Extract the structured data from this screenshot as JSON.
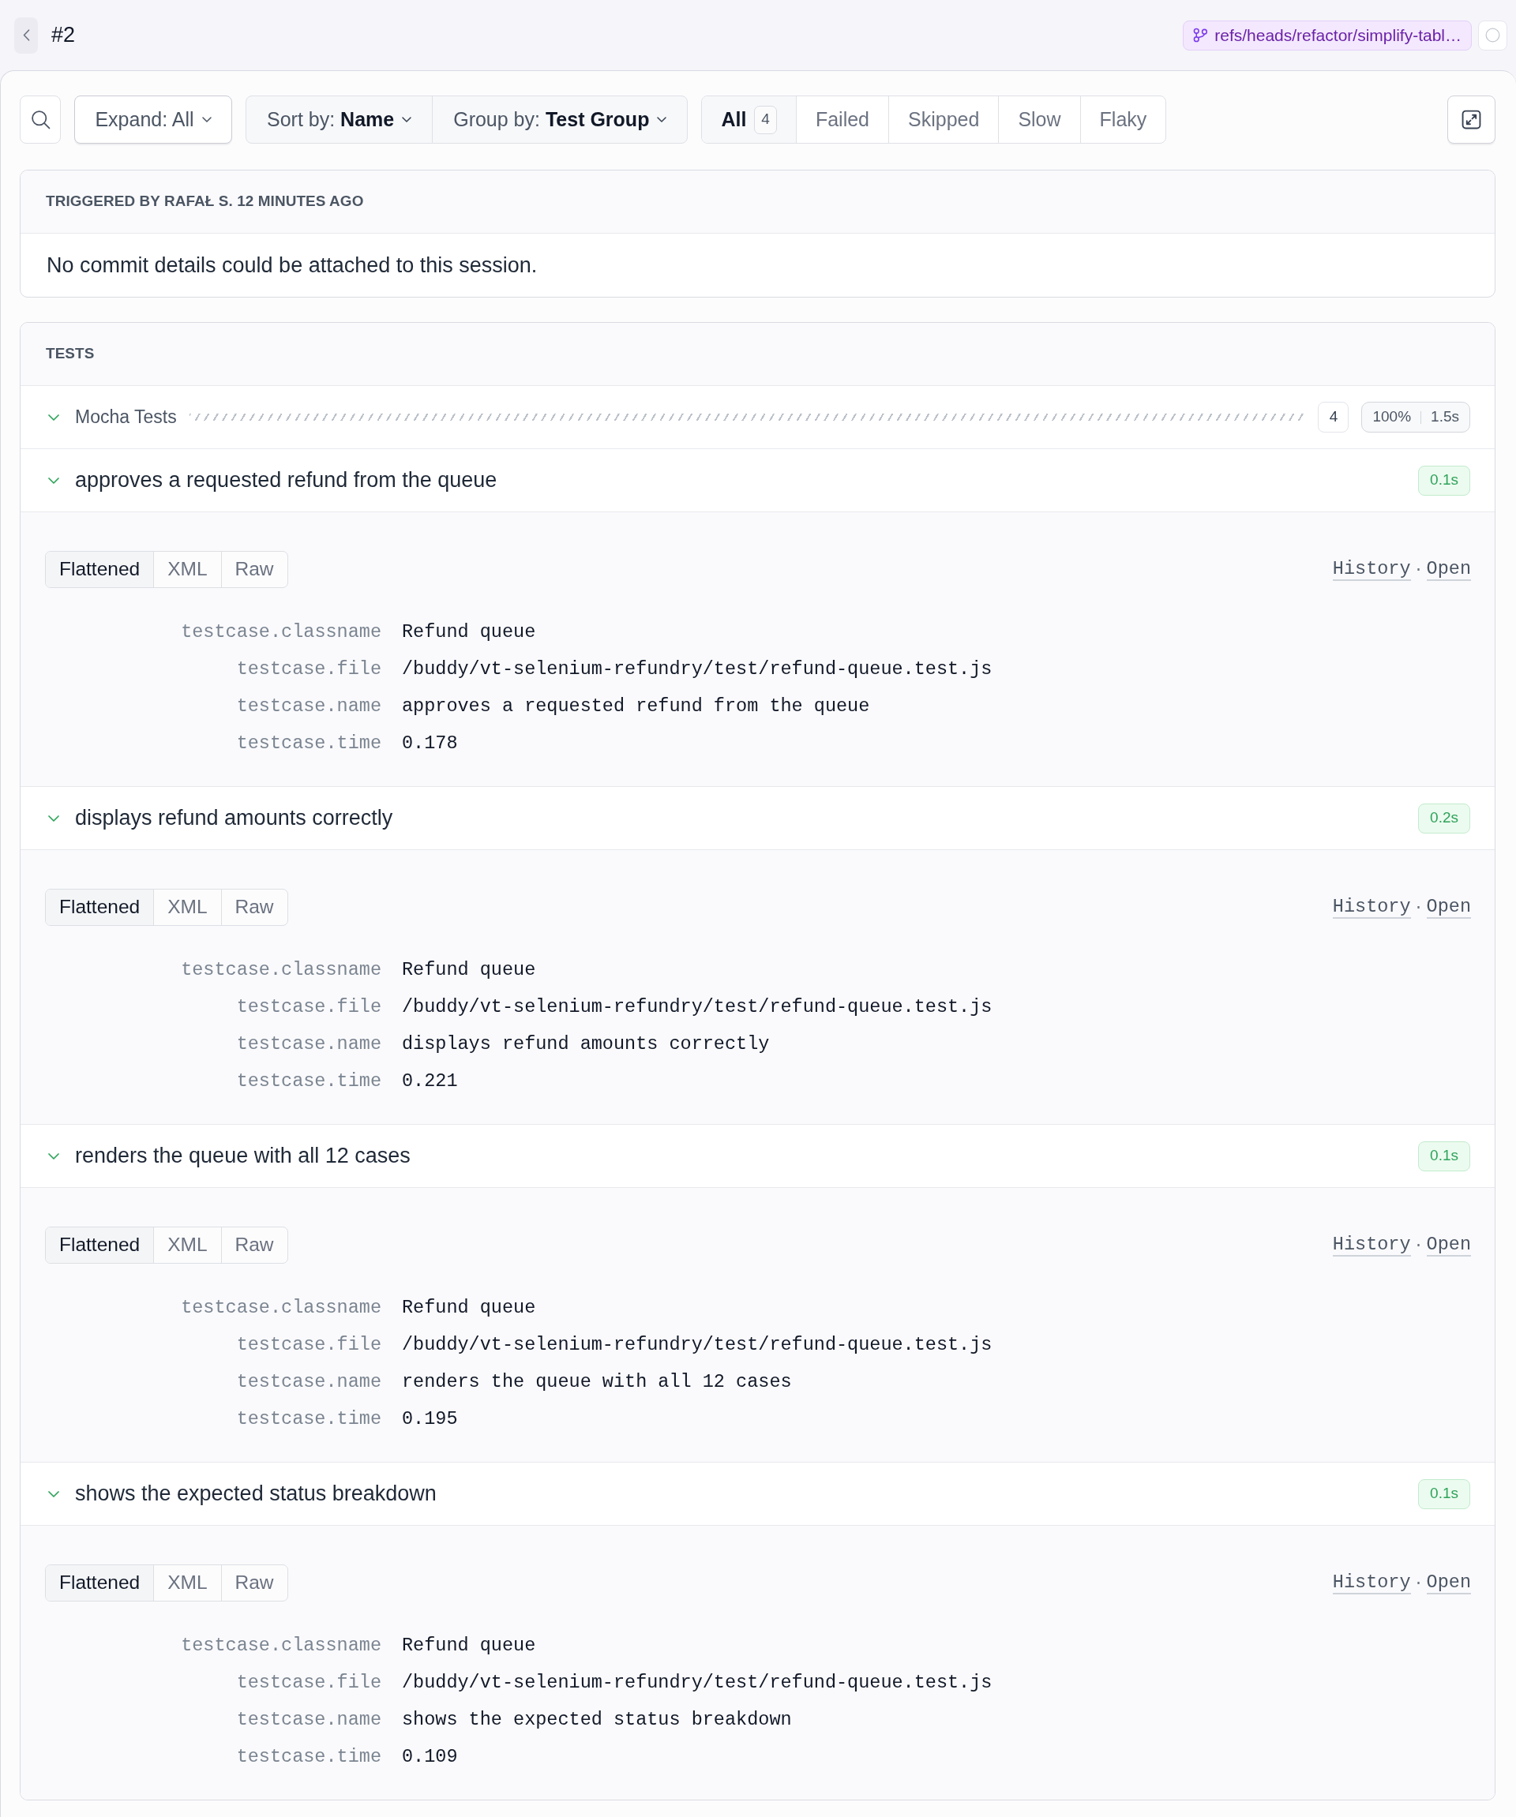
{
  "header": {
    "title": "#2",
    "branch": "refs/heads/refactor/simplify-tabl…"
  },
  "toolbar": {
    "expand": {
      "label": "Expand:",
      "value": "All"
    },
    "sort": {
      "label": "Sort by:",
      "value": "Name"
    },
    "group": {
      "label": "Group by:",
      "value": "Test Group"
    },
    "filters": [
      {
        "label": "All",
        "count": "4",
        "selected": true
      },
      {
        "label": "Failed",
        "selected": false
      },
      {
        "label": "Skipped",
        "selected": false
      },
      {
        "label": "Slow",
        "selected": false
      },
      {
        "label": "Flaky",
        "selected": false
      }
    ]
  },
  "trigger": {
    "heading": "TRIGGERED BY RAFAŁ S. 12 MINUTES AGO",
    "message": "No commit details could be attached to this session."
  },
  "tests": {
    "heading": "TESTS",
    "group": {
      "name": "Mocha Tests",
      "passed": true,
      "expanded": true,
      "count": "4",
      "pass_rate": "100%",
      "duration": "1.5s"
    },
    "cases": [
      {
        "name": "approves a requested refund from the queue",
        "passed": true,
        "expanded": true,
        "duration": "0.1s",
        "views": [
          {
            "label": "Flattened",
            "selected": true
          },
          {
            "label": "XML",
            "selected": false
          },
          {
            "label": "Raw",
            "selected": false
          }
        ],
        "links": [
          "History",
          "Open"
        ],
        "link_separator": "·",
        "fields": [
          {
            "key": "testcase.classname",
            "value": "Refund queue"
          },
          {
            "key": "testcase.file",
            "value": "/buddy/vt-selenium-refundry/test/refund-queue.test.js"
          },
          {
            "key": "testcase.name",
            "value": "approves a requested refund from the queue"
          },
          {
            "key": "testcase.time",
            "value": "0.178"
          }
        ]
      },
      {
        "name": "displays refund amounts correctly",
        "passed": true,
        "expanded": true,
        "duration": "0.2s",
        "views": [
          {
            "label": "Flattened",
            "selected": true
          },
          {
            "label": "XML",
            "selected": false
          },
          {
            "label": "Raw",
            "selected": false
          }
        ],
        "links": [
          "History",
          "Open"
        ],
        "link_separator": "·",
        "fields": [
          {
            "key": "testcase.classname",
            "value": "Refund queue"
          },
          {
            "key": "testcase.file",
            "value": "/buddy/vt-selenium-refundry/test/refund-queue.test.js"
          },
          {
            "key": "testcase.name",
            "value": "displays refund amounts correctly"
          },
          {
            "key": "testcase.time",
            "value": "0.221"
          }
        ]
      },
      {
        "name": "renders the queue with all 12 cases",
        "passed": true,
        "expanded": true,
        "duration": "0.1s",
        "views": [
          {
            "label": "Flattened",
            "selected": true
          },
          {
            "label": "XML",
            "selected": false
          },
          {
            "label": "Raw",
            "selected": false
          }
        ],
        "links": [
          "History",
          "Open"
        ],
        "link_separator": "·",
        "fields": [
          {
            "key": "testcase.classname",
            "value": "Refund queue"
          },
          {
            "key": "testcase.file",
            "value": "/buddy/vt-selenium-refundry/test/refund-queue.test.js"
          },
          {
            "key": "testcase.name",
            "value": "renders the queue with all 12 cases"
          },
          {
            "key": "testcase.time",
            "value": "0.195"
          }
        ]
      },
      {
        "name": "shows the expected status breakdown",
        "passed": true,
        "expanded": true,
        "duration": "0.1s",
        "views": [
          {
            "label": "Flattened",
            "selected": true
          },
          {
            "label": "XML",
            "selected": false
          },
          {
            "label": "Raw",
            "selected": false
          }
        ],
        "links": [
          "History",
          "Open"
        ],
        "link_separator": "·",
        "fields": [
          {
            "key": "testcase.classname",
            "value": "Refund queue"
          },
          {
            "key": "testcase.file",
            "value": "/buddy/vt-selenium-refundry/test/refund-queue.test.js"
          },
          {
            "key": "testcase.name",
            "value": "shows the expected status breakdown"
          },
          {
            "key": "testcase.time",
            "value": "0.109"
          }
        ]
      }
    ]
  }
}
